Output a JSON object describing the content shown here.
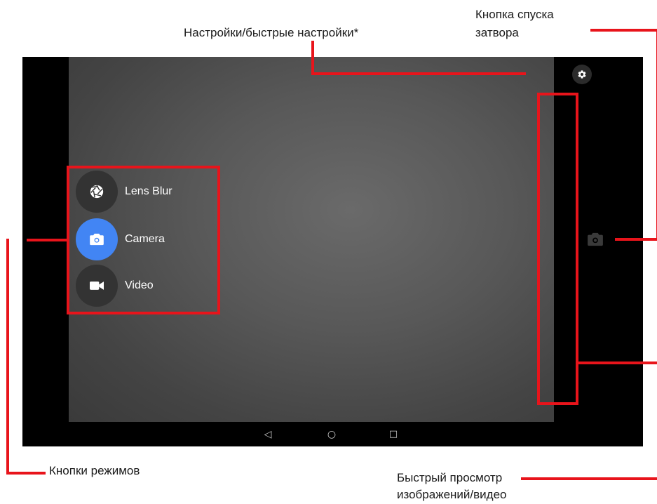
{
  "camera_ui": {
    "modes": [
      {
        "label": "Lens Blur",
        "icon": "aperture-icon",
        "active": false
      },
      {
        "label": "Camera",
        "icon": "camera-icon",
        "active": true
      },
      {
        "label": "Video",
        "icon": "videocam-icon",
        "active": false
      }
    ],
    "settings_icon": "gear-icon",
    "shutter_icon": "camera-icon",
    "nav_buttons": [
      "◁",
      "○",
      "□"
    ]
  },
  "annotations": {
    "settings": "Настройки/быстрые настройки*",
    "shutter_line1": "Кнопка спуска",
    "shutter_line2": "затвора",
    "modes": "Кнопки режимов",
    "preview_line1": "Быстрый просмотр",
    "preview_line2": "изображений/видео"
  },
  "colors": {
    "highlight": "#e8141b",
    "active_mode": "#4285f4",
    "mode_button": "#333333"
  }
}
